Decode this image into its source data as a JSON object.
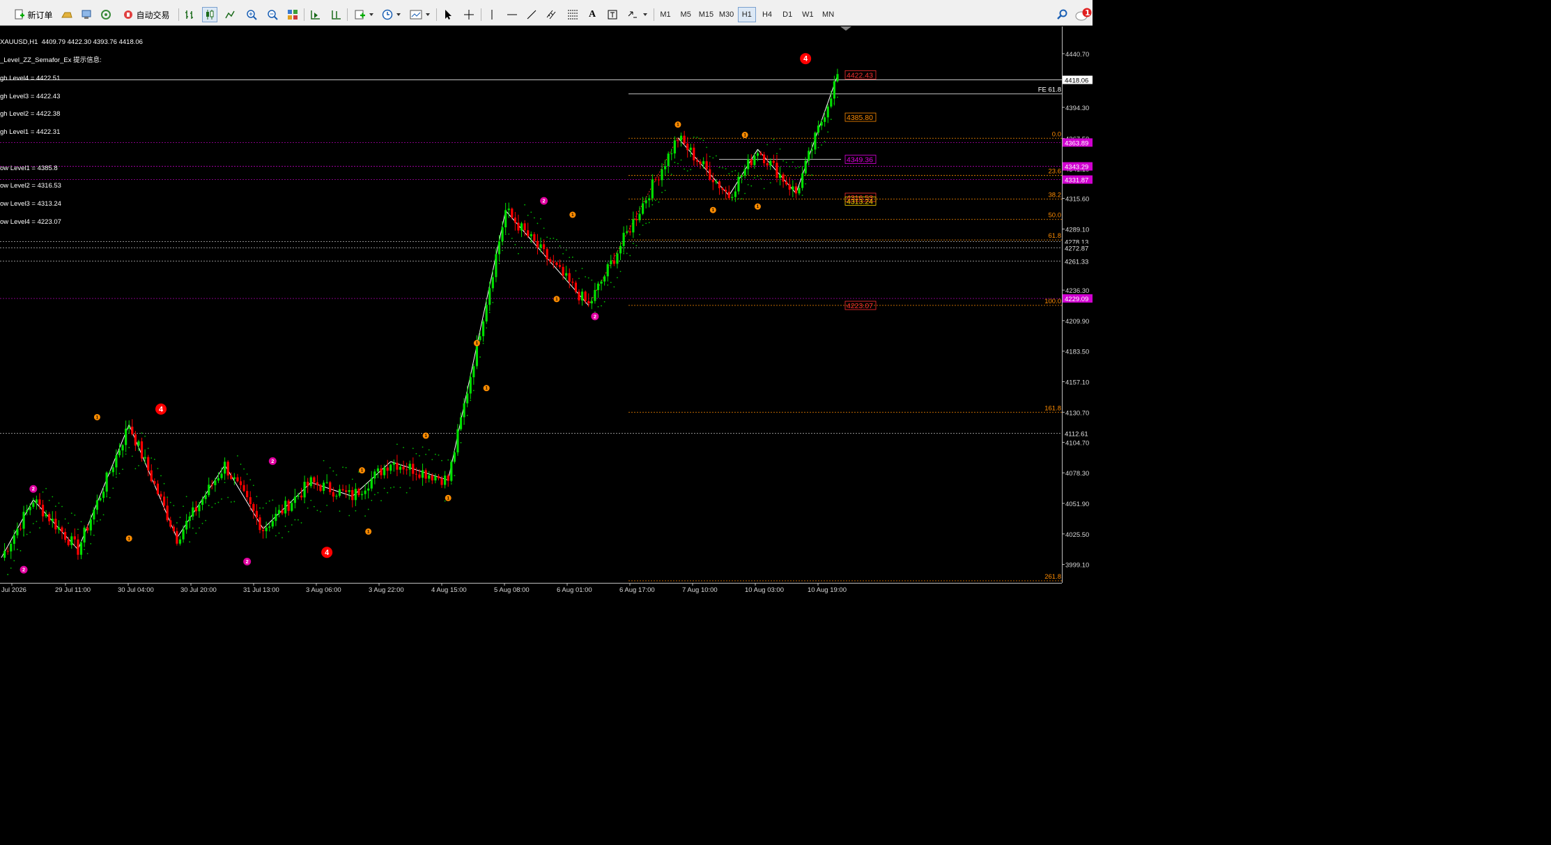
{
  "toolbar": {
    "new_order_label": "新订单",
    "auto_trade_label": "自动交易",
    "timeframes": [
      "M1",
      "M5",
      "M15",
      "M30",
      "H1",
      "H4",
      "D1",
      "W1",
      "MN"
    ],
    "active_timeframe": "H1",
    "notification_count": "1",
    "text_tool_label": "A"
  },
  "chart_header": {
    "symbol_line": "XAUUSD,H1  4409.79 4422.30 4393.76 4418.06",
    "indicator_title": "_Level_ZZ_Semafor_Ex 提示信息:",
    "levels": [
      "gh Level4 = 4422.51",
      "gh Level3 = 4422.43",
      "gh Level2 = 4422.38",
      "gh Level1 = 4422.31",
      "",
      "ow Level1 = 4385.8",
      "ow Level2 = 4316.53",
      "ow Level3 = 4313.24",
      "ow Level4 = 4223.07"
    ]
  },
  "colors": {
    "up_candle": "#00e000",
    "down_candle": "#ff0000",
    "magenta_line": "#d000d0",
    "orange_level": "#ff8c00",
    "semafor_magenta": "#e000a0",
    "semafor_orange": "#ff8c00",
    "semafor_red": "#ff0000",
    "sar_dots": "#00c000",
    "current_price_bg": "#ffffff"
  },
  "chart_data": {
    "type": "candlestick",
    "symbol": "XAUUSD",
    "timeframe": "H1",
    "ylim": [
      3985,
      4430
    ],
    "price_axis_ticks": [
      "4440.70",
      "4418.06",
      "4394.30",
      "4367.50",
      "4341.10",
      "4315.60",
      "4289.10",
      "4278.13",
      "4272.87",
      "4261.33",
      "4236.30",
      "4209.90",
      "4183.50",
      "4157.10",
      "4130.70",
      "4112.61",
      "4104.70",
      "4078.30",
      "4051.90",
      "4025.50",
      "3999.10"
    ],
    "price_labels": [
      {
        "text": "4418.06",
        "price": 4418.06,
        "kind": "current"
      },
      {
        "text": "4363.89",
        "price": 4363.89,
        "kind": "magenta"
      },
      {
        "text": "4343.29",
        "price": 4343.29,
        "kind": "magenta"
      },
      {
        "text": "4331.87",
        "price": 4331.87,
        "kind": "magenta"
      },
      {
        "text": "4278.13",
        "price": 4278.13,
        "kind": "white"
      },
      {
        "text": "4272.87",
        "price": 4272.87,
        "kind": "white"
      },
      {
        "text": "4261.33",
        "price": 4261.33,
        "kind": "white"
      },
      {
        "text": "4229.09",
        "price": 4229.09,
        "kind": "magenta"
      },
      {
        "text": "4112.61",
        "price": 4112.61,
        "kind": "white"
      }
    ],
    "time_ticks": [
      "Jul 2026",
      "29 Jul 11:00",
      "30 Jul 04:00",
      "30 Jul 20:00",
      "31 Jul 13:00",
      "3 Aug 06:00",
      "3 Aug 22:00",
      "4 Aug 15:00",
      "5 Aug 08:00",
      "6 Aug 01:00",
      "6 Aug 17:00",
      "7 Aug 10:00",
      "10 Aug 03:00",
      "10 Aug 19:00"
    ],
    "horizontal_lines": [
      {
        "price": 4418.06,
        "style": "solid",
        "color": "white"
      },
      {
        "price": 4363.89,
        "style": "dashed",
        "color": "magenta"
      },
      {
        "price": 4343.29,
        "style": "dashed",
        "color": "magenta"
      },
      {
        "price": 4331.87,
        "style": "dashed",
        "color": "magenta"
      },
      {
        "price": 4278.13,
        "style": "dashed",
        "color": "white"
      },
      {
        "price": 4272.87,
        "style": "dashed",
        "color": "white"
      },
      {
        "price": 4261.33,
        "style": "dashed",
        "color": "white"
      },
      {
        "price": 4229.09,
        "style": "dashed",
        "color": "magenta"
      },
      {
        "price": 4112.61,
        "style": "dashed",
        "color": "white"
      }
    ],
    "fibo_levels": [
      {
        "label": "FE 61.8",
        "price": 4405.9
      },
      {
        "label": "0.0",
        "price": 4367.6
      },
      {
        "label": "23.6",
        "price": 4335.4
      },
      {
        "label": "38.2",
        "price": 4315.0
      },
      {
        "label": "50.0",
        "price": 4297.4
      },
      {
        "label": "61.8",
        "price": 4279.7
      },
      {
        "label": "100.0",
        "price": 4223.1
      },
      {
        "label": "161.8",
        "price": 4130.7
      },
      {
        "label": "261.8",
        "price": 3985.0
      }
    ],
    "level_boxes": [
      {
        "text": "4422.43",
        "price": 4422.43,
        "color": "#ff3030"
      },
      {
        "text": "4385.80",
        "price": 4385.8,
        "color": "#ff8c00"
      },
      {
        "text": "4349.36",
        "price": 4349.36,
        "color": "#e000e0"
      },
      {
        "text": "4316.53",
        "price": 4316.53,
        "color": "#ff3030"
      },
      {
        "text": "4313.24",
        "price": 4313.24,
        "color": "#ffd700"
      },
      {
        "text": "4223.07",
        "price": 4223.07,
        "color": "#ff3030"
      }
    ],
    "zigzag": [
      {
        "bar": 0,
        "price": 4005
      },
      {
        "bar": 10,
        "price": 4055
      },
      {
        "bar": 24,
        "price": 4012
      },
      {
        "bar": 40,
        "price": 4120
      },
      {
        "bar": 55,
        "price": 4022
      },
      {
        "bar": 70,
        "price": 4085
      },
      {
        "bar": 82,
        "price": 4030
      },
      {
        "bar": 97,
        "price": 4070
      },
      {
        "bar": 110,
        "price": 4058
      },
      {
        "bar": 122,
        "price": 4088
      },
      {
        "bar": 140,
        "price": 4072
      },
      {
        "bar": 158,
        "price": 4305
      },
      {
        "bar": 184,
        "price": 4223
      },
      {
        "bar": 212,
        "price": 4368
      },
      {
        "bar": 228,
        "price": 4318
      },
      {
        "bar": 237,
        "price": 4358
      },
      {
        "bar": 249,
        "price": 4320
      },
      {
        "bar": 262,
        "price": 4422
      }
    ],
    "semafor_points": [
      {
        "bar": 10,
        "price": 4056,
        "label": "2",
        "kind": "magenta",
        "pos": "above"
      },
      {
        "bar": 7,
        "price": 4003,
        "label": "2",
        "kind": "magenta",
        "pos": "below"
      },
      {
        "bar": 30,
        "price": 4118,
        "label": "1",
        "kind": "orange",
        "pos": "above"
      },
      {
        "bar": 40,
        "price": 4030,
        "label": "1",
        "kind": "orange",
        "pos": "below"
      },
      {
        "bar": 50,
        "price": 4125,
        "label": "4",
        "kind": "red",
        "pos": "above"
      },
      {
        "bar": 77,
        "price": 4010,
        "label": "2",
        "kind": "magenta",
        "pos": "below"
      },
      {
        "bar": 85,
        "price": 4080,
        "label": "2",
        "kind": "magenta",
        "pos": "above"
      },
      {
        "bar": 102,
        "price": 4018,
        "label": "4",
        "kind": "red",
        "pos": "below"
      },
      {
        "bar": 113,
        "price": 4072,
        "label": "1",
        "kind": "orange",
        "pos": "above"
      },
      {
        "bar": 115,
        "price": 4036,
        "label": "1",
        "kind": "orange",
        "pos": "below"
      },
      {
        "bar": 133,
        "price": 4102,
        "label": "1",
        "kind": "orange",
        "pos": "above"
      },
      {
        "bar": 140,
        "price": 4065,
        "label": "1",
        "kind": "orange",
        "pos": "below"
      },
      {
        "bar": 149,
        "price": 4182,
        "label": "1",
        "kind": "orange",
        "pos": "above"
      },
      {
        "bar": 152,
        "price": 4160,
        "label": "1",
        "kind": "orange",
        "pos": "below"
      },
      {
        "bar": 170,
        "price": 4305,
        "label": "2",
        "kind": "magenta",
        "pos": "above"
      },
      {
        "bar": 174,
        "price": 4237,
        "label": "1",
        "kind": "orange",
        "pos": "below"
      },
      {
        "bar": 179,
        "price": 4293,
        "label": "1",
        "kind": "orange",
        "pos": "above"
      },
      {
        "bar": 186,
        "price": 4222,
        "label": "2",
        "kind": "magenta",
        "pos": "below"
      },
      {
        "bar": 212,
        "price": 4371,
        "label": "1",
        "kind": "orange",
        "pos": "above"
      },
      {
        "bar": 223,
        "price": 4314,
        "label": "1",
        "kind": "orange",
        "pos": "below"
      },
      {
        "bar": 233,
        "price": 4362,
        "label": "1",
        "kind": "orange",
        "pos": "above"
      },
      {
        "bar": 237,
        "price": 4317,
        "label": "1",
        "kind": "orange",
        "pos": "below"
      },
      {
        "bar": 252,
        "price": 4428,
        "label": "4",
        "kind": "red",
        "pos": "above"
      }
    ]
  }
}
